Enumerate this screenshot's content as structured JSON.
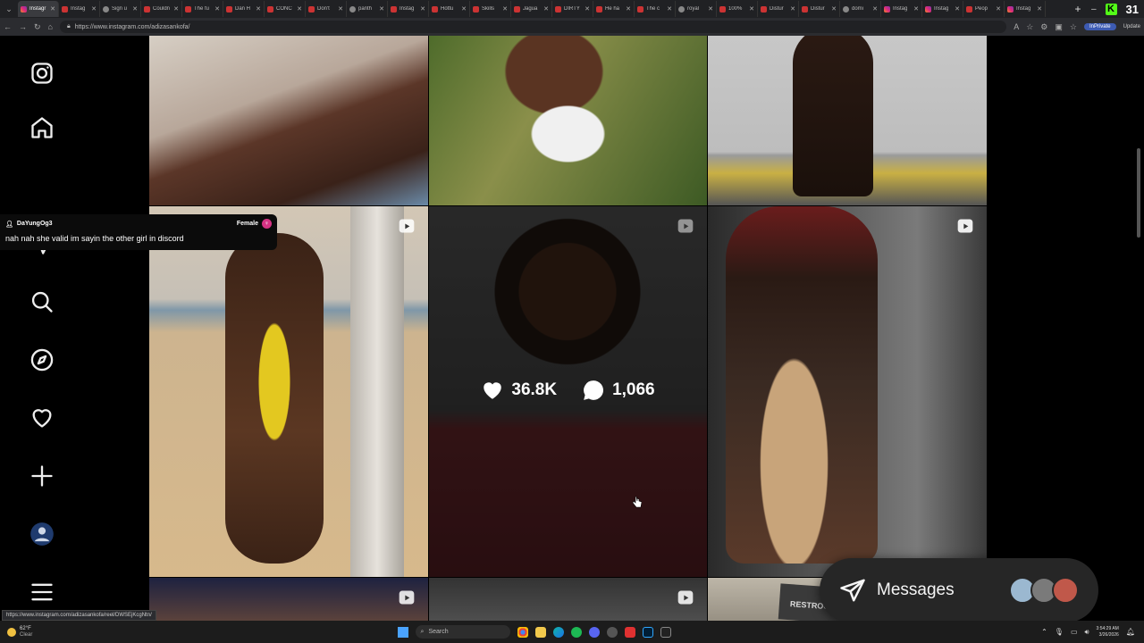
{
  "browser": {
    "tabs": [
      {
        "title": "Instagr",
        "icon": "instagram-icon",
        "active": true
      },
      {
        "title": "Instag",
        "icon": "youtube-icon"
      },
      {
        "title": "Sign u",
        "icon": "github-icon"
      },
      {
        "title": "Couldn",
        "icon": "youtube-icon"
      },
      {
        "title": "The fu",
        "icon": "youtube-icon"
      },
      {
        "title": "Dan H",
        "icon": "youtube-icon"
      },
      {
        "title": "CONC",
        "icon": "youtube-icon"
      },
      {
        "title": "Don't",
        "icon": "youtube-icon"
      },
      {
        "title": "panth",
        "icon": "search-icon"
      },
      {
        "title": "Instag",
        "icon": "youtube-icon"
      },
      {
        "title": "Hottu",
        "icon": "youtube-icon"
      },
      {
        "title": "Skills",
        "icon": "youtube-icon"
      },
      {
        "title": "Jagua",
        "icon": "youtube-icon"
      },
      {
        "title": "DIRTY",
        "icon": "youtube-icon"
      },
      {
        "title": "He ha",
        "icon": "youtube-icon"
      },
      {
        "title": "The c",
        "icon": "youtube-icon"
      },
      {
        "title": "royal",
        "icon": "github-icon"
      },
      {
        "title": "100%",
        "icon": "youtube-icon"
      },
      {
        "title": "Distur",
        "icon": "youtube-icon"
      },
      {
        "title": "Distur",
        "icon": "youtube-icon"
      },
      {
        "title": "domi",
        "icon": "github-icon"
      },
      {
        "title": "Instag",
        "icon": "instagram-icon"
      },
      {
        "title": "Instag",
        "icon": "instagram-icon"
      },
      {
        "title": "Peop",
        "icon": "youtube-icon"
      },
      {
        "title": "Instag",
        "icon": "instagram-icon"
      }
    ],
    "new_tab": "+",
    "kick_badge": "K",
    "kick_count": "31",
    "url": "https://www.instagram.com/adizasankofa/",
    "inprivate_label": "InPrivate",
    "update_label": "Update"
  },
  "sidebar": {
    "items": [
      "instagram-icon",
      "home-icon",
      "messages-icon",
      "search-icon",
      "explore-icon",
      "notifications-icon",
      "create-icon",
      "profile-avatar",
      "more-menu-icon"
    ]
  },
  "chat": {
    "username": "DaYungOg3",
    "gender_label": "Female",
    "message": "nah nah she valid im sayin the other girl in discord"
  },
  "post_stats": {
    "likes": "36.8K",
    "comments": "1,066"
  },
  "restroom_sign": "RESTROOMS",
  "messages_widget": {
    "label": "Messages",
    "avatar_colors": [
      "#9bb8d0",
      "#7a7a7a",
      "#c0584a"
    ]
  },
  "status_url": "https://www.instagram.com/adizasankofa/reel/DWSEjKcgNtn/",
  "taskbar": {
    "temperature": "62°F",
    "weather": "Clear",
    "search_placeholder": "Search",
    "time": "3:54:29 AM",
    "date": "3/26/2026"
  }
}
